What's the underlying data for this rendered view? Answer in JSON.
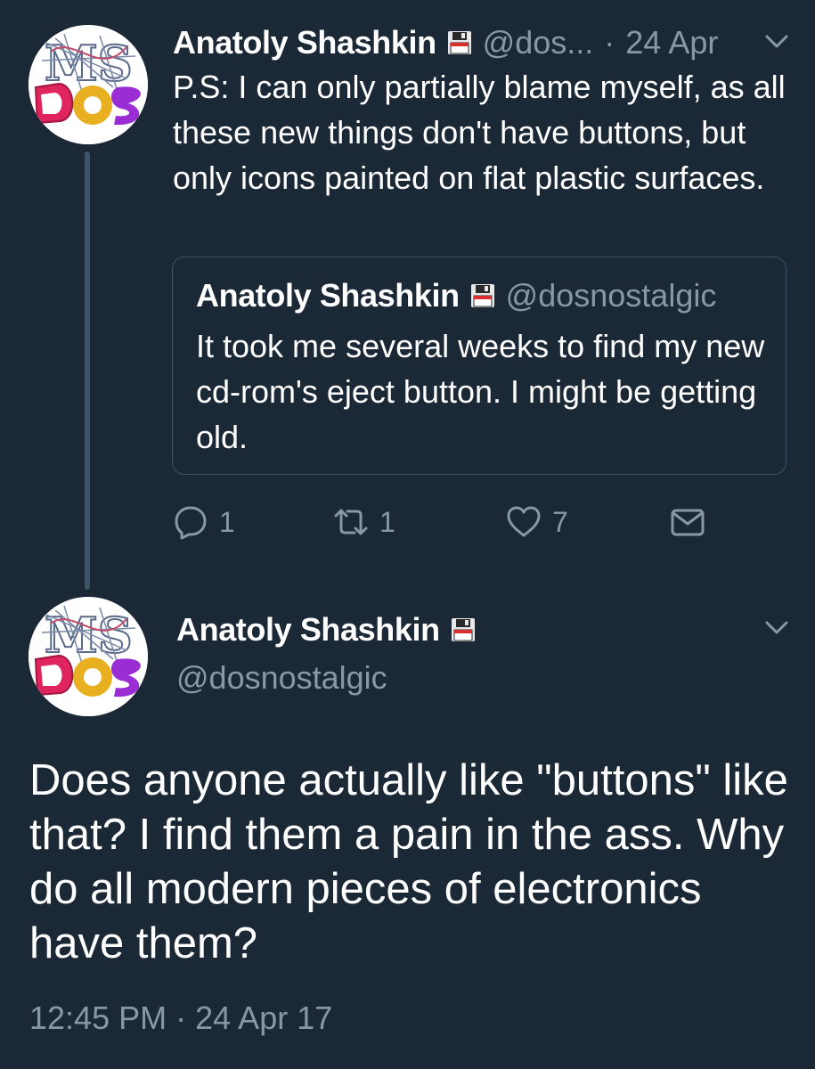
{
  "tweet1": {
    "author_name": "Anatoly Shashkin",
    "author_handle": "@dos...",
    "separator": "·",
    "date": "24 Apr",
    "text": "P.S: I can only partially blame myself, as all these new things don't have buttons, but only icons painted on flat plastic surfaces.",
    "quote": {
      "author_name": "Anatoly Shashkin",
      "author_handle": "@dosnostalgic",
      "text": "It took me several weeks to find my new cd-rom's eject button. I might be getting old."
    },
    "actions": {
      "replies": "1",
      "retweets": "1",
      "likes": "7"
    }
  },
  "tweet2": {
    "author_name": "Anatoly Shashkin",
    "author_handle": "@dosnostalgic",
    "text": "Does anyone actually like \"buttons\" like that? I find them a pain in the ass. Why do all modern pieces of electronics have them?",
    "time": "12:45 PM",
    "separator": "·",
    "date": "24 Apr 17"
  },
  "icons": {
    "floppy": "floppy-disk-icon",
    "menu": "chevron-down-icon",
    "reply": "reply-icon",
    "retweet": "retweet-icon",
    "like": "heart-icon",
    "message": "envelope-icon"
  },
  "colors": {
    "background": "#1b2836",
    "primary_text": "#ffffff",
    "secondary_text": "#8899a6",
    "border": "#3d5467"
  }
}
